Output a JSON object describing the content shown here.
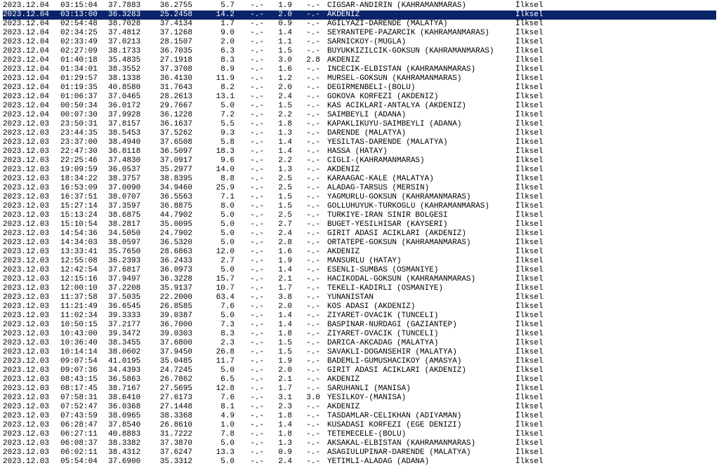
{
  "rows": [
    {
      "date": "2023.12.04",
      "time": "03:15:04",
      "lat": "37.7883",
      "lon": "36.2755",
      "depth": "5.7",
      "m1": "-.-",
      "m2": "1.9",
      "m3": "-.-",
      "loc": "CIGSAR-ANDIRIN (KAHRAMANMARAS)",
      "qual": "İlksel",
      "sel": false
    },
    {
      "date": "2023.12.04",
      "time": "03:13:00",
      "lat": "36.3283",
      "lon": "25.2458",
      "depth": "14.2",
      "m1": "-.-",
      "m2": "2.0",
      "m3": "-.-",
      "loc": "AKDENIZ",
      "qual": "İlksel",
      "sel": true
    },
    {
      "date": "2023.12.04",
      "time": "02:54:48",
      "lat": "38.7028",
      "lon": "37.4134",
      "depth": "1.7",
      "m1": "-.-",
      "m2": "0.9",
      "m3": "-.-",
      "loc": "AGILYAZI-DARENDE (MALATYA)",
      "qual": "İlksel",
      "sel": false
    },
    {
      "date": "2023.12.04",
      "time": "02:34:25",
      "lat": "37.4812",
      "lon": "37.1268",
      "depth": "9.0",
      "m1": "-.-",
      "m2": "1.4",
      "m3": "-.-",
      "loc": "SEYRANTEPE-PAZARCIK (KAHRAMANMARAS)",
      "qual": "İlksel",
      "sel": false
    },
    {
      "date": "2023.12.04",
      "time": "02:33:49",
      "lat": "37.0213",
      "lon": "28.1507",
      "depth": "2.0",
      "m1": "-.-",
      "m2": "1.1",
      "m3": "-.-",
      "loc": "SARNICKOY-(MUGLA)",
      "qual": "İlksel",
      "sel": false
    },
    {
      "date": "2023.12.04",
      "time": "02:27:09",
      "lat": "38.1733",
      "lon": "36.7035",
      "depth": "6.3",
      "m1": "-.-",
      "m2": "1.5",
      "m3": "-.-",
      "loc": "BUYUKKIZILCIK-GOKSUN (KAHRAMANMARAS)",
      "qual": "İlksel",
      "sel": false
    },
    {
      "date": "2023.12.04",
      "time": "01:40:18",
      "lat": "35.4835",
      "lon": "27.1918",
      "depth": "8.3",
      "m1": "-.-",
      "m2": "3.0",
      "m3": "2.8",
      "loc": "AKDENIZ",
      "qual": "İlksel",
      "sel": false
    },
    {
      "date": "2023.12.04",
      "time": "01:34:01",
      "lat": "38.3552",
      "lon": "37.3708",
      "depth": "8.9",
      "m1": "-.-",
      "m2": "1.6",
      "m3": "-.-",
      "loc": "INCECIK-ELBISTAN (KAHRAMANMARAS)",
      "qual": "İlksel",
      "sel": false
    },
    {
      "date": "2023.12.04",
      "time": "01:29:57",
      "lat": "38.1338",
      "lon": "36.4130",
      "depth": "11.9",
      "m1": "-.-",
      "m2": "1.2",
      "m3": "-.-",
      "loc": "MURSEL-GOKSUN (KAHRAMANMARAS)",
      "qual": "İlksel",
      "sel": false
    },
    {
      "date": "2023.12.04",
      "time": "01:19:35",
      "lat": "40.8580",
      "lon": "31.7643",
      "depth": "8.2",
      "m1": "-.-",
      "m2": "2.0",
      "m3": "-.-",
      "loc": "DEGIRMENBELI-(BOLU)",
      "qual": "İlksel",
      "sel": false
    },
    {
      "date": "2023.12.04",
      "time": "01:06:37",
      "lat": "37.0465",
      "lon": "28.2613",
      "depth": "13.1",
      "m1": "-.-",
      "m2": "2.4",
      "m3": "-.-",
      "loc": "GOKOVA KORFEZI (AKDENIZ)",
      "qual": "İlksel",
      "sel": false
    },
    {
      "date": "2023.12.04",
      "time": "00:50:34",
      "lat": "36.0172",
      "lon": "29.7667",
      "depth": "5.0",
      "m1": "-.-",
      "m2": "1.5",
      "m3": "-.-",
      "loc": "KAS ACIKLARI-ANTALYA (AKDENIZ)",
      "qual": "İlksel",
      "sel": false
    },
    {
      "date": "2023.12.04",
      "time": "00:07:30",
      "lat": "37.9928",
      "lon": "36.1228",
      "depth": "7.2",
      "m1": "-.-",
      "m2": "2.2",
      "m3": "-.-",
      "loc": "SAIMBEYLI (ADANA)",
      "qual": "İlksel",
      "sel": false
    },
    {
      "date": "2023.12.03",
      "time": "23:50:31",
      "lat": "37.8157",
      "lon": "36.1637",
      "depth": "5.5",
      "m1": "-.-",
      "m2": "1.8",
      "m3": "-.-",
      "loc": "KAPAKLIKUYU-SAIMBEYLI (ADANA)",
      "qual": "İlksel",
      "sel": false
    },
    {
      "date": "2023.12.03",
      "time": "23:44:35",
      "lat": "38.5453",
      "lon": "37.5262",
      "depth": "9.3",
      "m1": "-.-",
      "m2": "1.3",
      "m3": "-.-",
      "loc": "DARENDE (MALATYA)",
      "qual": "İlksel",
      "sel": false
    },
    {
      "date": "2023.12.03",
      "time": "23:37:00",
      "lat": "38.4940",
      "lon": "37.6508",
      "depth": "5.8",
      "m1": "-.-",
      "m2": "1.4",
      "m3": "-.-",
      "loc": "YESILTAS-DARENDE (MALATYA)",
      "qual": "İlksel",
      "sel": false
    },
    {
      "date": "2023.12.03",
      "time": "22:47:30",
      "lat": "36.8118",
      "lon": "36.5097",
      "depth": "18.3",
      "m1": "-.-",
      "m2": "1.4",
      "m3": "-.-",
      "loc": "HASSA (HATAY)",
      "qual": "İlksel",
      "sel": false
    },
    {
      "date": "2023.12.03",
      "time": "22:25:46",
      "lat": "37.4830",
      "lon": "37.0917",
      "depth": "9.6",
      "m1": "-.-",
      "m2": "2.2",
      "m3": "-.-",
      "loc": "CIGLI-(KAHRAMANMARAS)",
      "qual": "İlksel",
      "sel": false
    },
    {
      "date": "2023.12.03",
      "time": "19:09:59",
      "lat": "36.0537",
      "lon": "35.2977",
      "depth": "14.0",
      "m1": "-.-",
      "m2": "1.3",
      "m3": "-.-",
      "loc": "AKDENIZ",
      "qual": "İlksel",
      "sel": false
    },
    {
      "date": "2023.12.03",
      "time": "18:34:22",
      "lat": "38.3757",
      "lon": "38.8395",
      "depth": "8.8",
      "m1": "-.-",
      "m2": "2.5",
      "m3": "-.-",
      "loc": "KARAAGAC-KALE (MALATYA)",
      "qual": "İlksel",
      "sel": false
    },
    {
      "date": "2023.12.03",
      "time": "16:53:09",
      "lat": "37.0090",
      "lon": "34.9460",
      "depth": "25.9",
      "m1": "-.-",
      "m2": "2.5",
      "m3": "-.-",
      "loc": "ALADAG-TARSUS (MERSIN)",
      "qual": "İlksel",
      "sel": false
    },
    {
      "date": "2023.12.03",
      "time": "16:37:51",
      "lat": "38.0707",
      "lon": "36.5563",
      "depth": "7.1",
      "m1": "-.-",
      "m2": "1.5",
      "m3": "-.-",
      "loc": "YAGMURLU-GOKSUN (KAHRAMANMARAS)",
      "qual": "İlksel",
      "sel": false
    },
    {
      "date": "2023.12.03",
      "time": "15:27:14",
      "lat": "37.3597",
      "lon": "36.8875",
      "depth": "8.0",
      "m1": "-.-",
      "m2": "1.5",
      "m3": "-.-",
      "loc": "GOLLUHUYUK-TURKOGLU (KAHRAMANMARAS)",
      "qual": "İlksel",
      "sel": false
    },
    {
      "date": "2023.12.03",
      "time": "15:13:24",
      "lat": "38.6875",
      "lon": "44.7902",
      "depth": "5.0",
      "m1": "-.-",
      "m2": "2.5",
      "m3": "-.-",
      "loc": "TURKIYE-IRAN SINIR BOLGESI",
      "qual": "İlksel",
      "sel": false
    },
    {
      "date": "2023.12.03",
      "time": "15:10:54",
      "lat": "38.2817",
      "lon": "35.0095",
      "depth": "5.0",
      "m1": "-.-",
      "m2": "2.7",
      "m3": "-.-",
      "loc": "BUGET-YESILHISAR (KAYSERI)",
      "qual": "İlksel",
      "sel": false
    },
    {
      "date": "2023.12.03",
      "time": "14:54:36",
      "lat": "34.5050",
      "lon": "24.7902",
      "depth": "5.0",
      "m1": "-.-",
      "m2": "2.4",
      "m3": "-.-",
      "loc": "GIRIT ADASI ACIKLARI (AKDENIZ)",
      "qual": "İlksel",
      "sel": false
    },
    {
      "date": "2023.12.03",
      "time": "14:34:03",
      "lat": "38.0597",
      "lon": "36.5320",
      "depth": "5.0",
      "m1": "-.-",
      "m2": "2.8",
      "m3": "-.-",
      "loc": "ORTATEPE-GOKSUN (KAHRAMANMARAS)",
      "qual": "İlksel",
      "sel": false
    },
    {
      "date": "2023.12.03",
      "time": "13:33:41",
      "lat": "35.7650",
      "lon": "28.6863",
      "depth": "12.0",
      "m1": "-.-",
      "m2": "1.6",
      "m3": "-.-",
      "loc": "AKDENIZ",
      "qual": "İlksel",
      "sel": false
    },
    {
      "date": "2023.12.03",
      "time": "12:55:08",
      "lat": "36.2393",
      "lon": "36.2433",
      "depth": "2.7",
      "m1": "-.-",
      "m2": "1.9",
      "m3": "-.-",
      "loc": "MANSURLU (HATAY)",
      "qual": "İlksel",
      "sel": false
    },
    {
      "date": "2023.12.03",
      "time": "12:42:54",
      "lat": "37.6817",
      "lon": "36.0973",
      "depth": "5.0",
      "m1": "-.-",
      "m2": "1.4",
      "m3": "-.-",
      "loc": "ESENLI-SUMBAS (OSMANIYE)",
      "qual": "İlksel",
      "sel": false
    },
    {
      "date": "2023.12.03",
      "time": "12:15:16",
      "lat": "37.9497",
      "lon": "36.3228",
      "depth": "15.7",
      "m1": "-.-",
      "m2": "2.1",
      "m3": "-.-",
      "loc": "HACIKODAL-GOKSUN (KAHRAMANMARAS)",
      "qual": "İlksel",
      "sel": false
    },
    {
      "date": "2023.12.03",
      "time": "12:00:10",
      "lat": "37.2208",
      "lon": "35.9137",
      "depth": "10.7",
      "m1": "-.-",
      "m2": "1.7",
      "m3": "-.-",
      "loc": "TEKELI-KADIRLI (OSMANIYE)",
      "qual": "İlksel",
      "sel": false
    },
    {
      "date": "2023.12.03",
      "time": "11:37:58",
      "lat": "37.5035",
      "lon": "22.2000",
      "depth": "63.4",
      "m1": "-.-",
      "m2": "3.8",
      "m3": "-.-",
      "loc": "YUNANISTAN",
      "qual": "İlksel",
      "sel": false
    },
    {
      "date": "2023.12.03",
      "time": "11:21:49",
      "lat": "36.6545",
      "lon": "26.8585",
      "depth": "7.6",
      "m1": "-.-",
      "m2": "2.0",
      "m3": "-.-",
      "loc": "KOS ADASI (AKDENIZ)",
      "qual": "İlksel",
      "sel": false
    },
    {
      "date": "2023.12.03",
      "time": "11:02:34",
      "lat": "39.3333",
      "lon": "39.0387",
      "depth": "5.0",
      "m1": "-.-",
      "m2": "1.4",
      "m3": "-.-",
      "loc": "ZIYARET-OVACIK (TUNCELI)",
      "qual": "İlksel",
      "sel": false
    },
    {
      "date": "2023.12.03",
      "time": "10:50:15",
      "lat": "37.2177",
      "lon": "36.7000",
      "depth": "7.3",
      "m1": "-.-",
      "m2": "1.4",
      "m3": "-.-",
      "loc": "BASPINAR-NURDAGI (GAZIANTEP)",
      "qual": "İlksel",
      "sel": false
    },
    {
      "date": "2023.12.03",
      "time": "10:43:00",
      "lat": "39.3472",
      "lon": "39.0303",
      "depth": "8.3",
      "m1": "-.-",
      "m2": "1.8",
      "m3": "-.-",
      "loc": "ZIYARET-OVACIK (TUNCELI)",
      "qual": "İlksel",
      "sel": false
    },
    {
      "date": "2023.12.03",
      "time": "10:36:40",
      "lat": "38.3455",
      "lon": "37.6800",
      "depth": "2.3",
      "m1": "-.-",
      "m2": "1.5",
      "m3": "-.-",
      "loc": "DARICA-AKCADAG (MALATYA)",
      "qual": "İlksel",
      "sel": false
    },
    {
      "date": "2023.12.03",
      "time": "10:14:14",
      "lat": "38.0602",
      "lon": "37.9450",
      "depth": "26.8",
      "m1": "-.-",
      "m2": "1.5",
      "m3": "-.-",
      "loc": "SAVAKLI-DOGANSEHIR (MALATYA)",
      "qual": "İlksel",
      "sel": false
    },
    {
      "date": "2023.12.03",
      "time": "09:07:54",
      "lat": "41.0195",
      "lon": "35.0485",
      "depth": "11.7",
      "m1": "-.-",
      "m2": "1.9",
      "m3": "-.-",
      "loc": "BADEMLI-GUMUSHACIKOY (AMASYA)",
      "qual": "İlksel",
      "sel": false
    },
    {
      "date": "2023.12.03",
      "time": "09:07:36",
      "lat": "34.4393",
      "lon": "24.7245",
      "depth": "5.0",
      "m1": "-.-",
      "m2": "2.0",
      "m3": "-.-",
      "loc": "GIRIT ADASI ACIKLARI (AKDENIZ)",
      "qual": "İlksel",
      "sel": false
    },
    {
      "date": "2023.12.03",
      "time": "08:43:15",
      "lat": "36.5863",
      "lon": "26.7862",
      "depth": "6.5",
      "m1": "-.-",
      "m2": "2.1",
      "m3": "-.-",
      "loc": "AKDENIZ",
      "qual": "İlksel",
      "sel": false
    },
    {
      "date": "2023.12.03",
      "time": "08:17:45",
      "lat": "38.7167",
      "lon": "27.5695",
      "depth": "12.8",
      "m1": "-.-",
      "m2": "1.7",
      "m3": "-.-",
      "loc": "SARUHANLI (MANISA)",
      "qual": "İlksel",
      "sel": false
    },
    {
      "date": "2023.12.03",
      "time": "07:58:31",
      "lat": "38.6410",
      "lon": "27.6173",
      "depth": "7.6",
      "m1": "-.-",
      "m2": "3.1",
      "m3": "3.0",
      "loc": "YESILKOY-(MANISA)",
      "qual": "İlksel",
      "sel": false
    },
    {
      "date": "2023.12.03",
      "time": "07:52:47",
      "lat": "36.0368",
      "lon": "27.1448",
      "depth": "8.1",
      "m1": "-.-",
      "m2": "2.3",
      "m3": "-.-",
      "loc": "AKDENIZ",
      "qual": "İlksel",
      "sel": false
    },
    {
      "date": "2023.12.03",
      "time": "07:43:59",
      "lat": "38.0965",
      "lon": "38.3368",
      "depth": "4.9",
      "m1": "-.-",
      "m2": "1.8",
      "m3": "-.-",
      "loc": "TASDAMLAR-CELIKHAN (ADIYAMAN)",
      "qual": "İlksel",
      "sel": false
    },
    {
      "date": "2023.12.03",
      "time": "06:28:47",
      "lat": "37.8540",
      "lon": "26.8610",
      "depth": "1.0",
      "m1": "-.-",
      "m2": "1.4",
      "m3": "-.-",
      "loc": "KUSADASI KORFEZI (EGE DENIZI)",
      "qual": "İlksel",
      "sel": false
    },
    {
      "date": "2023.12.03",
      "time": "06:27:11",
      "lat": "40.8883",
      "lon": "31.7222",
      "depth": "7.8",
      "m1": "-.-",
      "m2": "1.8",
      "m3": "-.-",
      "loc": "TETEMECELE-(BOLU)",
      "qual": "İlksel",
      "sel": false
    },
    {
      "date": "2023.12.03",
      "time": "06:08:37",
      "lat": "38.3382",
      "lon": "37.3870",
      "depth": "5.0",
      "m1": "-.-",
      "m2": "1.3",
      "m3": "-.-",
      "loc": "AKSAKAL-ELBISTAN (KAHRAMANMARAS)",
      "qual": "İlksel",
      "sel": false
    },
    {
      "date": "2023.12.03",
      "time": "06:02:11",
      "lat": "38.4312",
      "lon": "37.6247",
      "depth": "13.3",
      "m1": "-.-",
      "m2": "0.9",
      "m3": "-.-",
      "loc": "ASAGIULUPINAR-DARENDE (MALATYA)",
      "qual": "İlksel",
      "sel": false
    },
    {
      "date": "2023.12.03",
      "time": "05:54:04",
      "lat": "37.6900",
      "lon": "35.3312",
      "depth": "5.0",
      "m1": "-.-",
      "m2": "2.4",
      "m3": "-.-",
      "loc": "YETIMLI-ALADAG (ADANA)",
      "qual": "İlksel",
      "sel": false
    }
  ]
}
